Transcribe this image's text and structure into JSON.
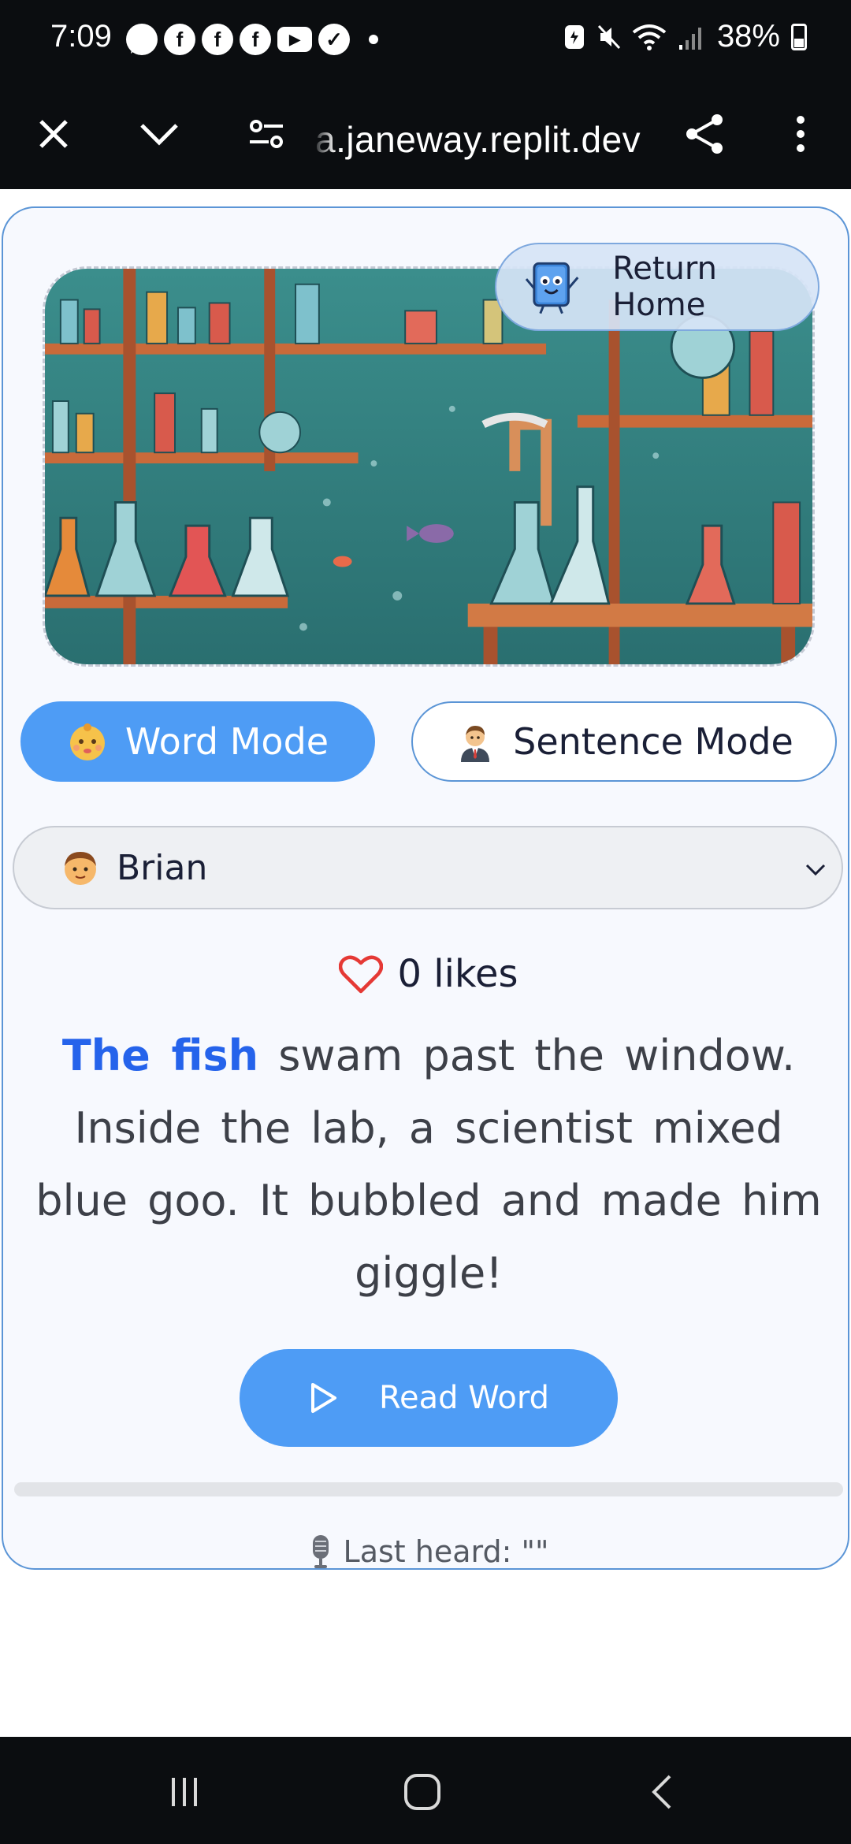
{
  "status_bar": {
    "time": "7:09",
    "battery": "38%",
    "notification_icons": [
      "chat-icon",
      "facebook-icon",
      "facebook-icon",
      "facebook-icon",
      "youtube-icon",
      "check-icon"
    ]
  },
  "browser": {
    "url": "a.janeway.replit.dev"
  },
  "page": {
    "return_home": "Return Home",
    "modes": {
      "word": "Word Mode",
      "sentence": "Sentence Mode",
      "selected": "word"
    },
    "voice": {
      "selected": "Brian"
    },
    "likes": {
      "count": "0",
      "label": "0 likes"
    },
    "story": {
      "highlight": "The fish",
      "rest": "swam past the window. Inside the lab, a scientist mixed blue goo. It bubbled and made him giggle!"
    },
    "read_button": "Read Word",
    "progress": 0,
    "last_heard": "Last heard: \"\""
  },
  "colors": {
    "accent": "#4e9cf5",
    "highlight_text": "#2563eb",
    "heart": "#e53935",
    "card_border": "#5b95d6"
  }
}
